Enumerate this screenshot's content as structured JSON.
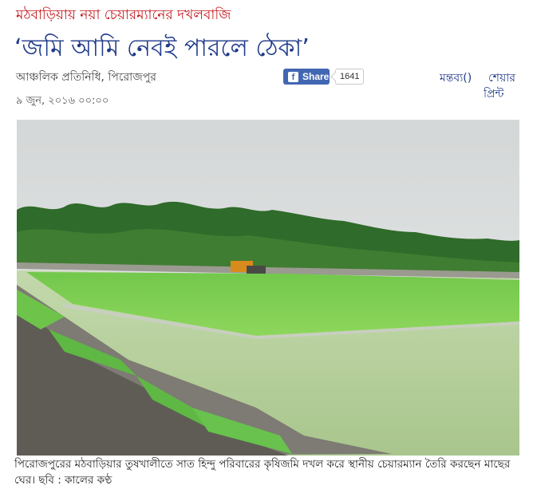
{
  "article": {
    "kicker": "মঠবাড়িয়ায় নয়া চেয়ারম্যানের দখলবাজি",
    "headline": "‘জমি আমি নেবই পারলে ঠেকা’",
    "byline": "আঞ্চলিক প্রতিনিধি, পিরোজপুর",
    "date": "৯ জুন, ২০১৬ ০০:০০",
    "photo_caption": "পিরোজপুরের মঠবাড়িয়ার তুষখালীতে সাত হিন্দু পরিবারের কৃষিজমি দখল করে স্থানীয় চেয়ারম্যান তৈরি করছেন মাছের ঘের। ছবি : কালের কণ্ঠ"
  },
  "social": {
    "facebook_icon": "f",
    "share_label": "Share",
    "share_count": "1641",
    "comment_link": "মন্তব্য()",
    "share_link": "শেয়ার",
    "print_link": "প্রিন্ট",
    "facebook_color": "#4267b2"
  },
  "colors": {
    "kicker": "#c4161c",
    "headline": "#1f3a8a"
  }
}
